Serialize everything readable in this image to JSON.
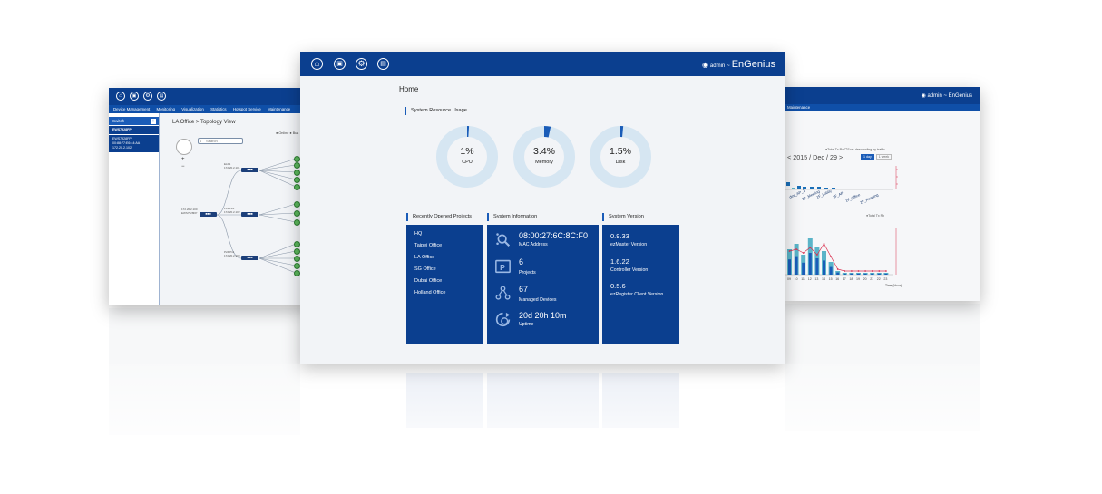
{
  "left_window": {
    "menu": [
      "Device Management",
      "Monitoring",
      "Visualization",
      "Statistics",
      "Hotspot Service",
      "Maintenance"
    ],
    "sidebar_header": "Switch",
    "sidebar_add": "+",
    "sidebar_items": [
      {
        "name": "EWS7928FP"
      },
      {
        "name": "EWS7928FP",
        "mac": "00:88:77:E6:44:AA",
        "ip": "172.20.2.102"
      }
    ],
    "title": "LA Office > Topology View",
    "status_legend": "● Online ● Bus",
    "search_placeholder": "Search",
    "zoom_in": "+",
    "zoom_out": "−",
    "nodes": [
      {
        "label": "ELP0",
        "ip": "172.20.2.100",
        "model": "EWS7928FP"
      },
      {
        "label": "ELP1",
        "ip": "172.20.2.101",
        "model": "EWS7928FP"
      },
      {
        "label": "P11 P24",
        "ip": "172.20.2.102",
        "model": "EWS7928FP"
      },
      {
        "label": "P24 P11",
        "ip": "172.20.2.103",
        "model": "EWS7928FP"
      }
    ]
  },
  "right_window": {
    "brand": "admin ~ EnGenius",
    "menu": "Maintenance",
    "legend_top": "●Total  Tx  Rx  ☐Sort: descending by traffic",
    "date": "< 2015 / Dec / 29 >",
    "tab_day": "1 day",
    "tab_week": "1 week",
    "legend_mid": "●Total  Tx  Rx",
    "x_ticks": [
      "09",
      "10",
      "11",
      "12",
      "13",
      "14",
      "15",
      "16",
      "17",
      "18",
      "19",
      "20",
      "21",
      "22",
      "23"
    ],
    "x_axis_label": "Time (Hour)"
  },
  "main_window": {
    "brand_user": "admin",
    "brand_sep": "~",
    "brand_name": "EnGenius",
    "page_title": "Home",
    "resource_title": "System Resource Usage",
    "resources": [
      {
        "value": "1%",
        "label": "CPU",
        "percent": 1
      },
      {
        "value": "3.4%",
        "label": "Memory",
        "percent": 3.4
      },
      {
        "value": "1.5%",
        "label": "Disk",
        "percent": 1.5
      }
    ],
    "projects_title": "Recently Opened Projects",
    "projects": [
      "HQ",
      "Taipei Office",
      "LA Office",
      "SG Office",
      "Dubai Office",
      "Holland Office"
    ],
    "info_title": "System Information",
    "info": [
      {
        "icon": "network-search-icon",
        "value": "08:00:27:6C:8C:F0",
        "label": "MAC Address"
      },
      {
        "icon": "project-folder-icon",
        "value": "6",
        "label": "Projects"
      },
      {
        "icon": "topology-icon",
        "value": "67",
        "label": "Managed Devices"
      },
      {
        "icon": "uptime-icon",
        "value": "20d 20h 10m",
        "label": "Uptime"
      }
    ],
    "version_title": "System Version",
    "versions": [
      {
        "value": "0.9.33",
        "label": "ezMaster Version"
      },
      {
        "value": "1.6.22",
        "label": "Controller Version"
      },
      {
        "value": "0.5.6",
        "label": "ezRegister Client Version"
      }
    ]
  },
  "colors": {
    "brand_blue": "#0b3f8f",
    "accent_blue": "#1a5cb8",
    "donut_track": "#d6e6f2",
    "chart_red": "#d9304f",
    "chart_teal": "#5ab4c8",
    "online_green": "#5cb85c"
  }
}
